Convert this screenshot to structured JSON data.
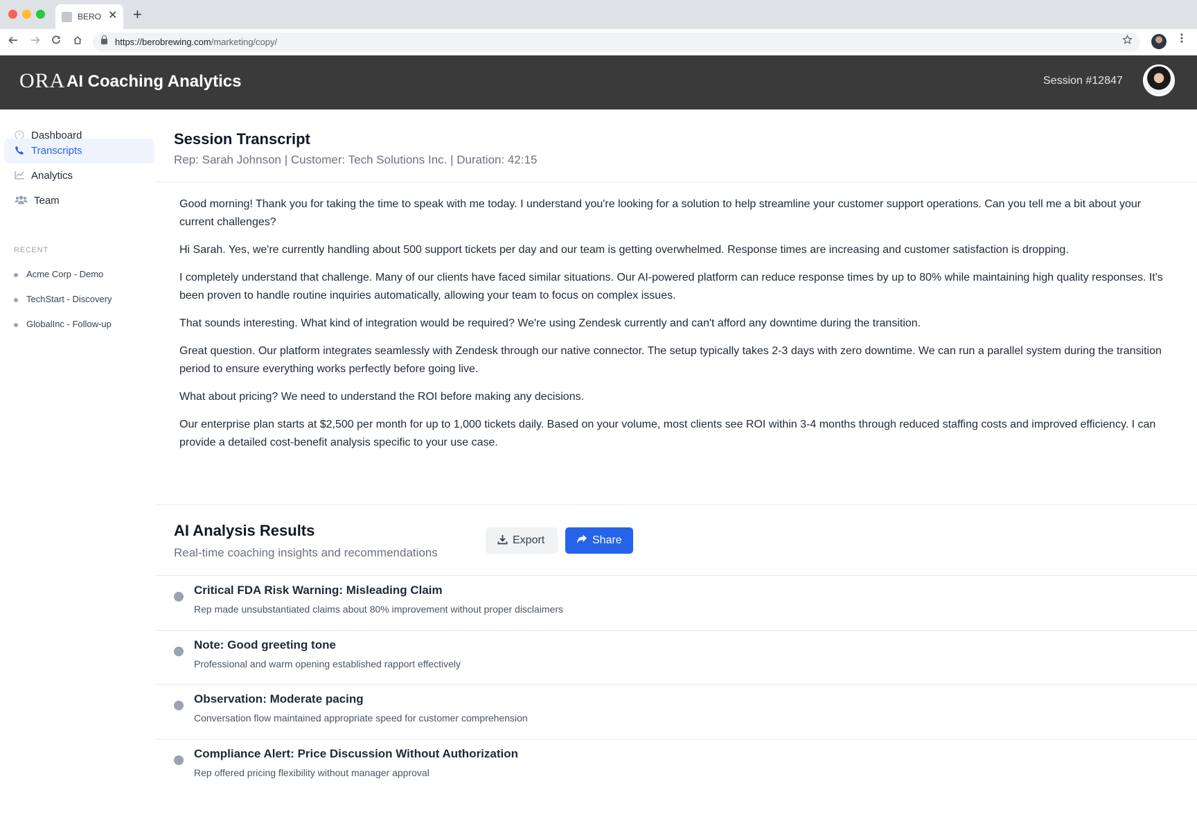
{
  "browser": {
    "tab_title": "BERO",
    "tab_close": "✕",
    "new_tab": "+",
    "url_host": "https://berobrewing.com",
    "url_path": "/marketing/copy/"
  },
  "header": {
    "logo": "ORA",
    "title": "AI Coaching Analytics",
    "session": "Session #12847"
  },
  "sidebar": {
    "items": [
      {
        "label": "Dashboard",
        "icon": "dashboard-icon",
        "active": false
      },
      {
        "label": "Transcripts",
        "icon": "phone-icon",
        "active": true
      },
      {
        "label": "Analytics",
        "icon": "chart-line-icon",
        "active": false
      },
      {
        "label": "Team",
        "icon": "users-icon",
        "active": false
      }
    ],
    "recent_heading": "RECENT",
    "recent": [
      {
        "label": "Acme Corp - Demo"
      },
      {
        "label": "TechStart - Discovery"
      },
      {
        "label": "GlobalInc - Follow-up"
      }
    ]
  },
  "transcript": {
    "title": "Session Transcript",
    "meta": "Rep: Sarah Johnson | Customer: Tech Solutions Inc. | Duration: 42:15",
    "lines": [
      "Good morning! Thank you for taking the time to speak with me today. I understand you're looking for a solution to help streamline your customer support operations. Can you tell me a bit about your current challenges?",
      "Hi Sarah. Yes, we're currently handling about 500 support tickets per day and our team is getting overwhelmed. Response times are increasing and customer satisfaction is dropping.",
      "I completely understand that challenge. Many of our clients have faced similar situations. Our AI-powered platform can reduce response times by up to 80% while maintaining high quality responses. It's been proven to handle routine inquiries automatically, allowing your team to focus on complex issues.",
      "That sounds interesting. What kind of integration would be required? We're using Zendesk currently and can't afford any downtime during the transition.",
      "Great question. Our platform integrates seamlessly with Zendesk through our native connector. The setup typically takes 2-3 days with zero downtime. We can run a parallel system during the transition period to ensure everything works perfectly before going live.",
      "What about pricing? We need to understand the ROI before making any decisions.",
      "Our enterprise plan starts at $2,500 per month for up to 1,000 tickets daily. Based on your volume, most clients see ROI within 3-4 months through reduced staffing costs and improved efficiency. I can provide a detailed cost-benefit analysis specific to your use case."
    ]
  },
  "analysis": {
    "title": "AI Analysis Results",
    "subtitle": "Real-time coaching insights and recommendations",
    "export_label": "Export",
    "share_label": "Share",
    "results": [
      {
        "title": "Critical FDA Risk Warning: Misleading Claim",
        "desc": "Rep made unsubstantiated claims about 80% improvement without proper disclaimers"
      },
      {
        "title": "Note: Good greeting tone",
        "desc": "Professional and warm opening established rapport effectively"
      },
      {
        "title": "Observation: Moderate pacing",
        "desc": "Conversation flow maintained appropriate speed for customer comprehension"
      },
      {
        "title": "Compliance Alert: Price Discussion Without Authorization",
        "desc": "Rep offered pricing flexibility without manager approval"
      }
    ]
  },
  "colors": {
    "accent": "#2563eb",
    "header_bg": "#3a3a3a",
    "active_bg": "#eff4ff",
    "dot": "#9ca3af"
  }
}
